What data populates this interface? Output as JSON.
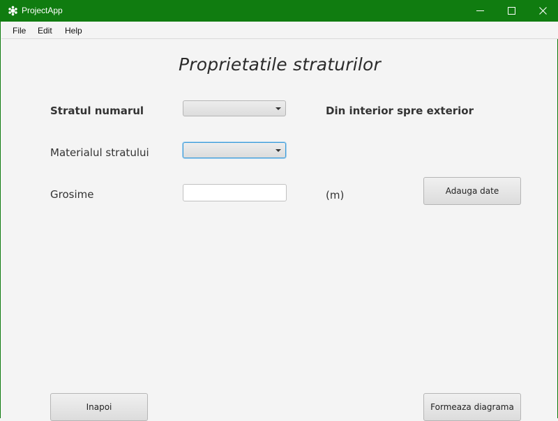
{
  "window": {
    "title": "ProjectApp",
    "accent_color": "#107c10",
    "controls": [
      "minimize-icon",
      "maximize-icon",
      "close-icon"
    ]
  },
  "menu": {
    "items": [
      "File",
      "Edit",
      "Help"
    ]
  },
  "page": {
    "title": "Proprietatile straturilor"
  },
  "form": {
    "layer_number_label": "Stratul numarul",
    "layer_number_value": "",
    "direction_note": "Din interior spre exterior",
    "material_label": "Materialul stratului",
    "material_value": "",
    "thickness_label": "Grosime",
    "thickness_value": "",
    "thickness_unit": "(m)",
    "add_button": "Adauga date"
  },
  "footer": {
    "back_button": "Inapoi",
    "diagram_button": "Formeaza diagrama"
  }
}
